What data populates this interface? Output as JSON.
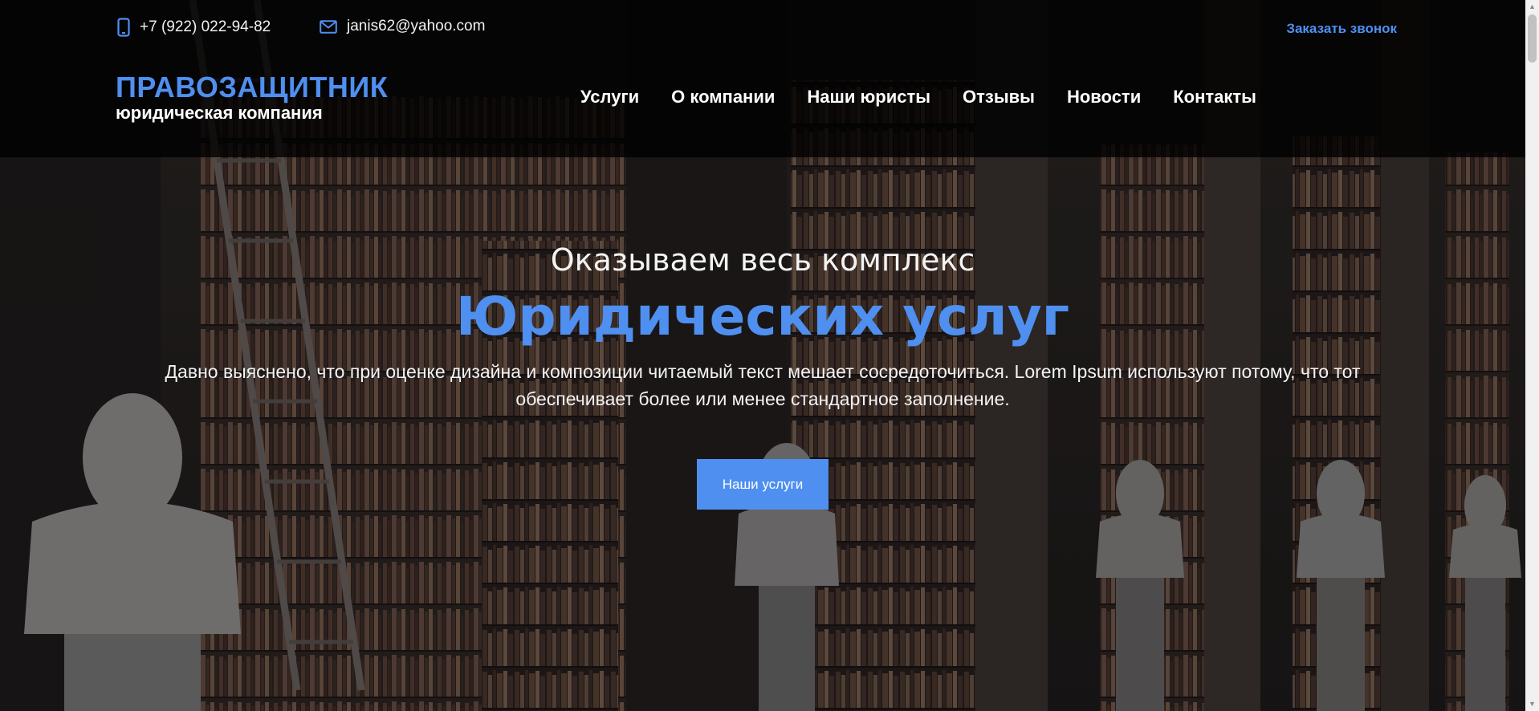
{
  "header": {
    "phone": "+7 (922) 022-94-82",
    "email": "janis62@yahoo.com",
    "callback_label": "Заказать звонок",
    "logo_title": "ПРАВОЗАЩИТНИК",
    "logo_subtitle": "юридическая компания",
    "nav": [
      "Услуги",
      "О компании",
      "Наши юристы",
      "Отзывы",
      "Новости",
      "Контакты"
    ]
  },
  "hero": {
    "pretitle": "Оказываем весь комплекс",
    "title": "Юридических услуг",
    "text": "Давно выяснено, что при оценке дизайна и композиции читаемый текст мешает сосредоточиться. Lorem Ipsum используют потому, что тот обеспечивает более или менее стандартное заполнение.",
    "button_label": "Наши услуги"
  },
  "icons": {
    "phone": "phone-icon",
    "email": "mail-icon"
  },
  "colors": {
    "accent": "#4f8ff0",
    "header_bg": "rgba(0,0,0,0.80)",
    "text": "#ffffff"
  }
}
